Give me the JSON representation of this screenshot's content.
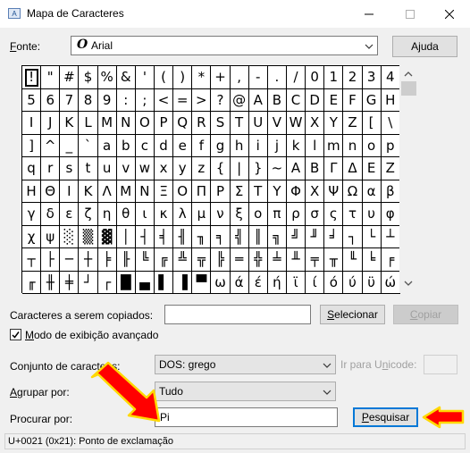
{
  "window": {
    "title": "Mapa de Caracteres",
    "icon": "charmap-app-icon",
    "controls": [
      "minimize-icon",
      "maximize-icon",
      "close-icon"
    ]
  },
  "font": {
    "label_hotkey": "F",
    "label_rest": "onte:",
    "value": "Arial",
    "font_glyph": "O",
    "help_hotkey": "j",
    "help_pre": "A",
    "help_post": "uda"
  },
  "grid": {
    "rows": [
      [
        "!",
        "\"",
        "#",
        "$",
        "%",
        "&",
        "'",
        "(",
        ")",
        "*",
        "+",
        ",",
        "-",
        ".",
        "/",
        "0",
        "1",
        "2",
        "3",
        "4"
      ],
      [
        "5",
        "6",
        "7",
        "8",
        "9",
        ":",
        ";",
        "<",
        "=",
        ">",
        "?",
        "@",
        "A",
        "B",
        "C",
        "D",
        "E",
        "F",
        "G",
        "H"
      ],
      [
        "I",
        "J",
        "K",
        "L",
        "M",
        "N",
        "O",
        "P",
        "Q",
        "R",
        "S",
        "T",
        "U",
        "V",
        "W",
        "X",
        "Y",
        "Z",
        "[",
        "\\"
      ],
      [
        "]",
        "^",
        "_",
        "`",
        "a",
        "b",
        "c",
        "d",
        "e",
        "f",
        "g",
        "h",
        "i",
        "j",
        "k",
        "l",
        "m",
        "n",
        "o",
        "p"
      ],
      [
        "q",
        "r",
        "s",
        "t",
        "u",
        "v",
        "w",
        "x",
        "y",
        "z",
        "{",
        "|",
        "}",
        "~",
        "Α",
        "Β",
        "Γ",
        "Δ",
        "Ε",
        "Ζ"
      ],
      [
        "Η",
        "Θ",
        "Ι",
        "Κ",
        "Λ",
        "Μ",
        "Ν",
        "Ξ",
        "Ο",
        "Π",
        "Ρ",
        "Σ",
        "Τ",
        "Υ",
        "Φ",
        "Χ",
        "Ψ",
        "Ω",
        "α",
        "β"
      ],
      [
        "γ",
        "δ",
        "ε",
        "ζ",
        "η",
        "θ",
        "ι",
        "κ",
        "λ",
        "μ",
        "ν",
        "ξ",
        "ο",
        "π",
        "ρ",
        "σ",
        "ς",
        "τ",
        "υ",
        "φ"
      ],
      [
        "χ",
        "ψ",
        "░",
        "▒",
        "▓",
        "│",
        "┤",
        "╡",
        "╢",
        "╖",
        "╕",
        "╣",
        "║",
        "╗",
        "╝",
        "╜",
        "╛",
        "┐",
        "└",
        "┴"
      ],
      [
        "┬",
        "├",
        "─",
        "┼",
        "╞",
        "╟",
        "╚",
        "╔",
        "╩",
        "╦",
        "╠",
        "═",
        "╬",
        "╧",
        "╨",
        "╤",
        "╥",
        "╙",
        "╘",
        "╒"
      ],
      [
        "╓",
        "╫",
        "╪",
        "┘",
        "┌",
        "█",
        "▄",
        "▌",
        "▐",
        "▀",
        "ω",
        "ά",
        "έ",
        "ή",
        "ϊ",
        "ί",
        "ό",
        "ύ",
        "ϋ",
        "ώ"
      ]
    ],
    "selected": "!"
  },
  "copy": {
    "label": "Caracteres a serem copiados:",
    "value": "",
    "select_hotkey": "S",
    "select_rest": "elecionar",
    "copy_hotkey": "C",
    "copy_rest": "opiar"
  },
  "advanced": {
    "hotkey": "M",
    "rest": "odo de exibição avançado",
    "checked": true
  },
  "charset": {
    "label_pre": "Conjunto de caracte",
    "label_post": "es:",
    "value": "DOS: grego",
    "goto_pre": "Ir para U",
    "goto_hotkey": "n",
    "goto_post": "icode:",
    "goto_value": ""
  },
  "group": {
    "label_hotkey": "A",
    "label_rest": "grupar por:",
    "value": "Tudo"
  },
  "search": {
    "label": "Procurar por:",
    "value": "Pi",
    "button_hotkey": "P",
    "button_rest": "esquisar"
  },
  "status": {
    "text": "U+0021 (0x21): Ponto de exclamação"
  },
  "annotation": {
    "arrow_color": "#ff0000",
    "arrow_outline": "#ffd800"
  }
}
